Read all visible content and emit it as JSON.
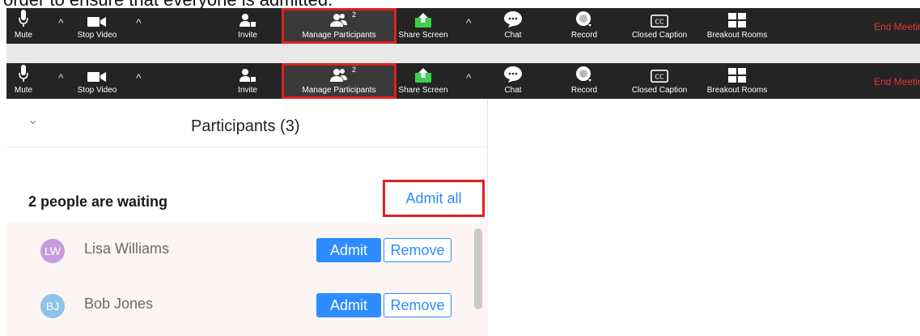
{
  "caption": "order to ensure that everyone is admitted.",
  "toolbar": {
    "mute_label": "Mute",
    "stop_video_label": "Stop Video",
    "invite_label": "Invite",
    "manage_participants_label": "Manage Participants",
    "participant_count": "2",
    "share_screen_label": "Share Screen",
    "chat_label": "Chat",
    "record_label": "Record",
    "closed_caption_label": "Closed Caption",
    "breakout_rooms_label": "Breakout Rooms",
    "end_meeting_label": "End Meeting",
    "caret": "^",
    "cc_icon_text": "CC"
  },
  "panel": {
    "title": "Participants (3)",
    "waiting_label": "2 people are waiting",
    "admit_all_label": "Admit all",
    "collapse_glyph": "⌄"
  },
  "waiting": [
    {
      "initials": "LW",
      "name": "Lisa Williams",
      "avatar_color": "#c79bdc",
      "admit_label": "Admit",
      "remove_label": "Remove"
    },
    {
      "initials": "BJ",
      "name": "Bob Jones",
      "avatar_color": "#8cc3e6",
      "admit_label": "Admit",
      "remove_label": "Remove"
    }
  ],
  "colors": {
    "toolbar_bg": "#242424",
    "highlight": "#e02020",
    "accent": "#2d8cff",
    "end_meeting": "#e0383e",
    "share_green": "#3bd14a"
  }
}
